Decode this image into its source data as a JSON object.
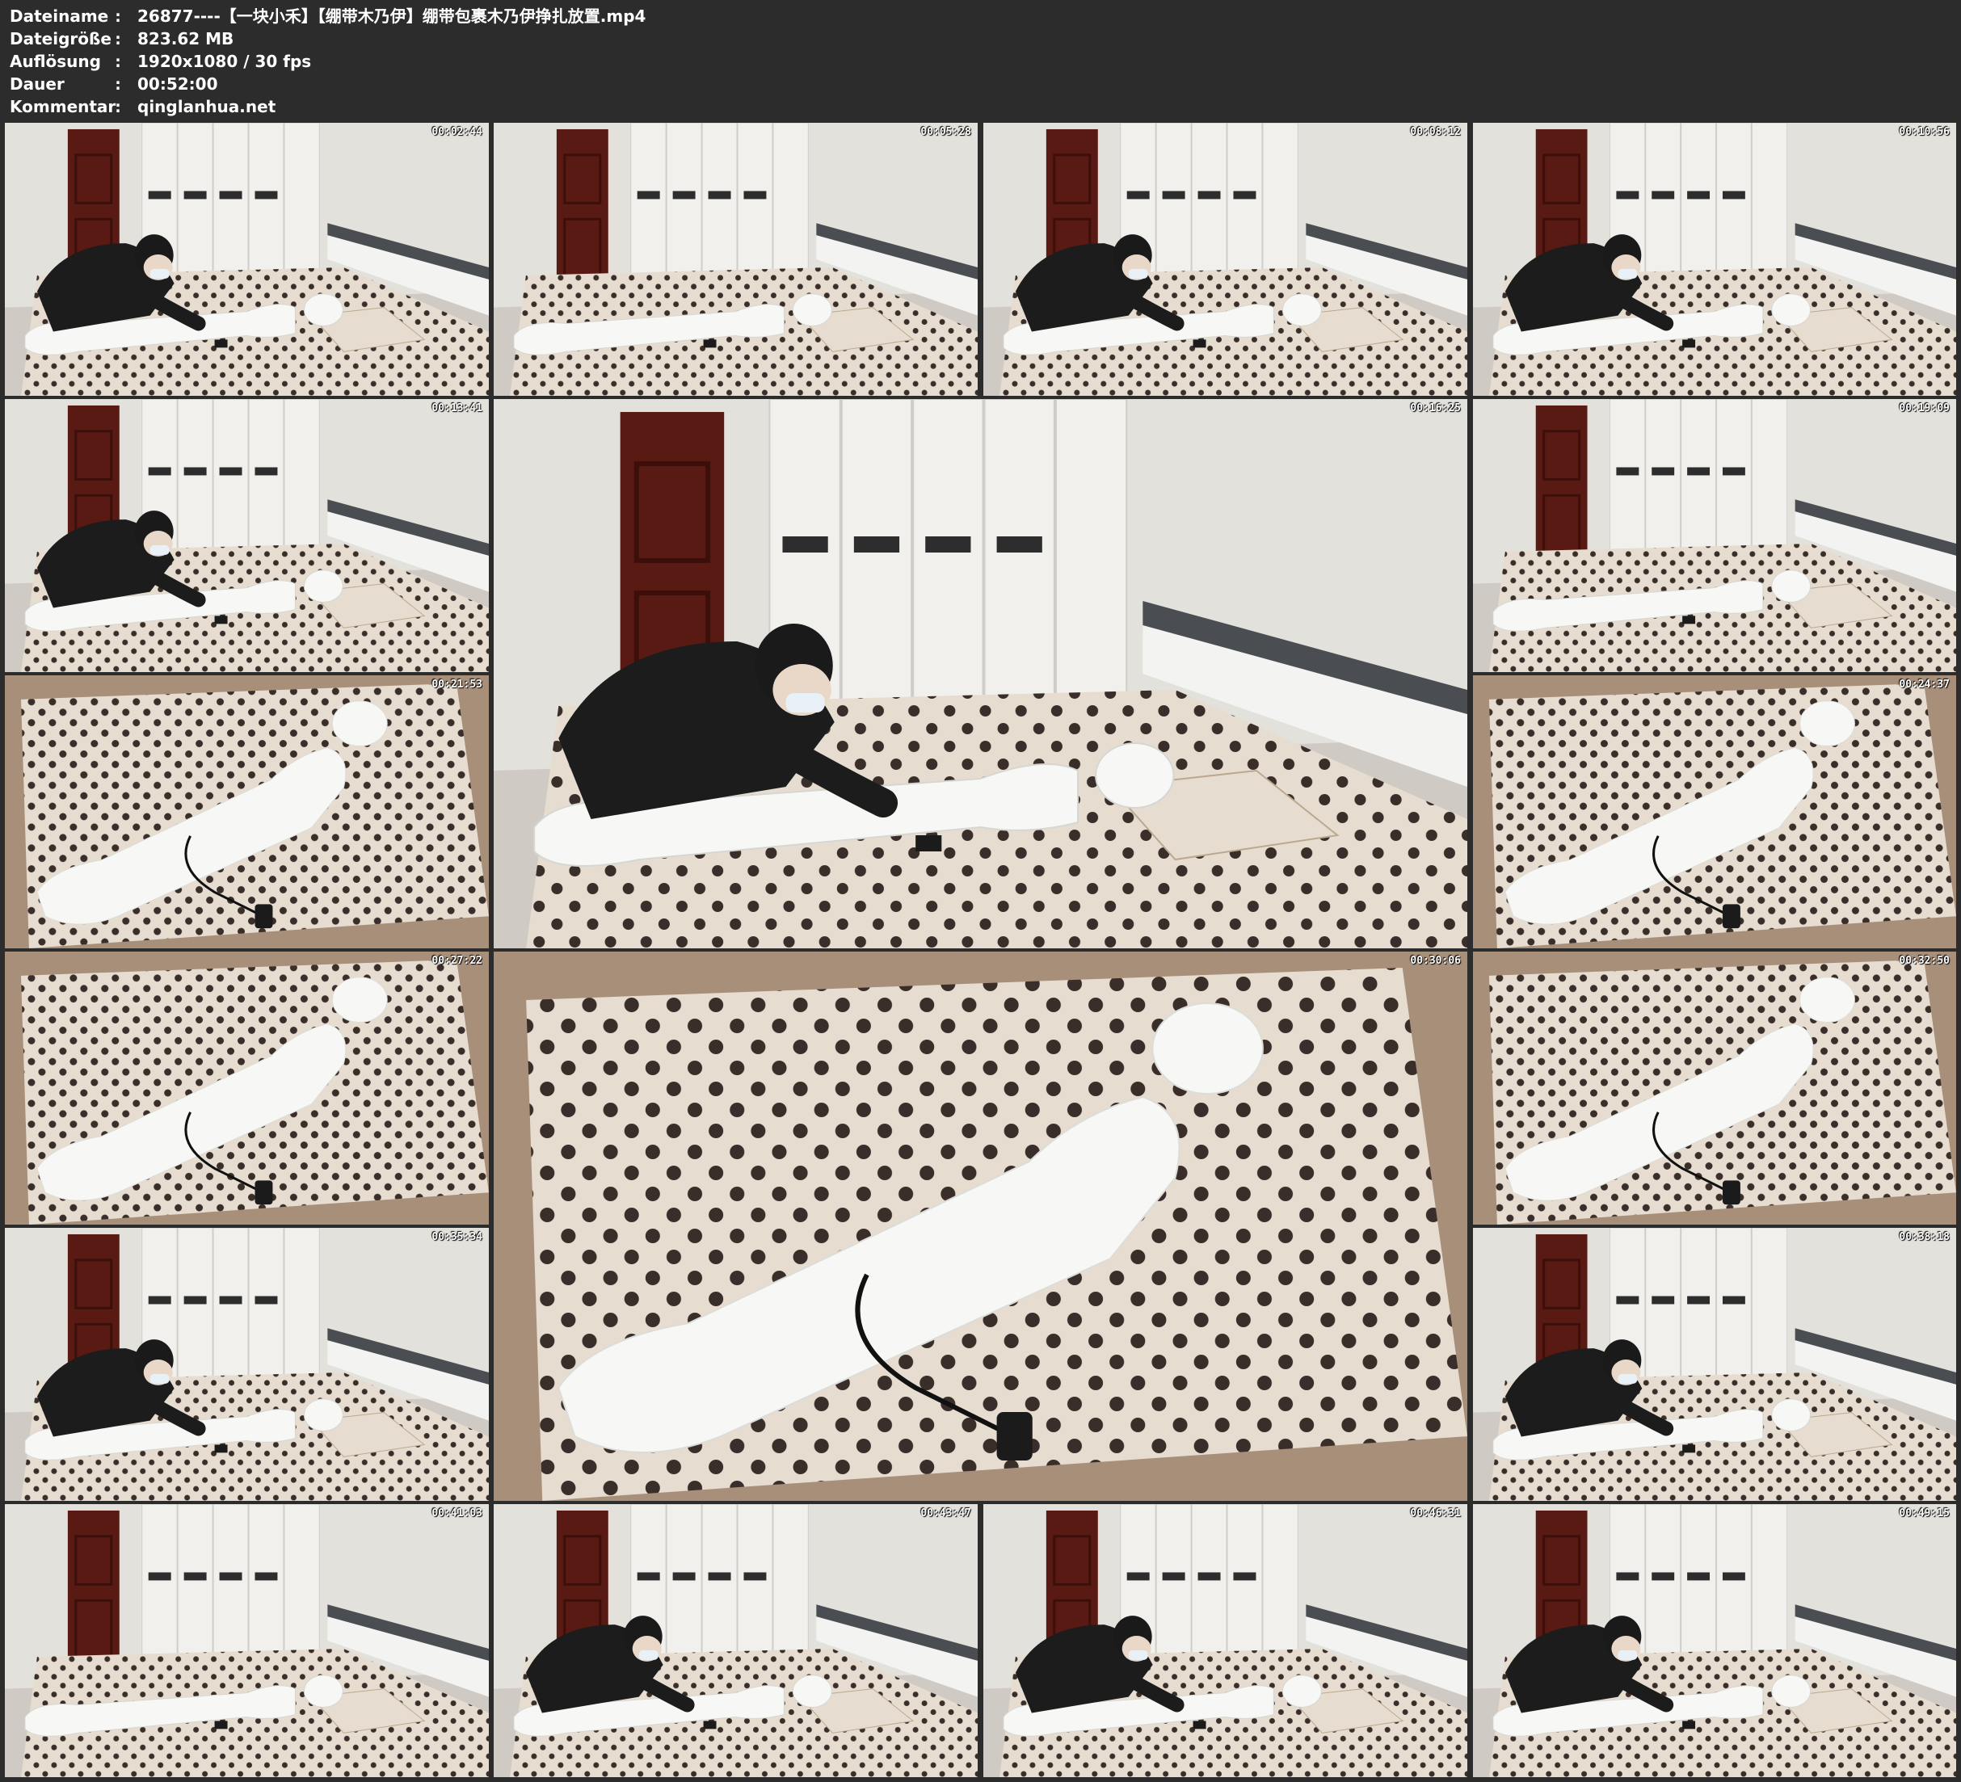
{
  "info": [
    {
      "label": "Dateiname",
      "value": "26877----【一块小禾】【绷带木乃伊】绷带包裹木乃伊挣扎放置.mp4"
    },
    {
      "label": "Dateigröße",
      "value": "823.62 MB"
    },
    {
      "label": "Auflösung",
      "value": "1920x1080 / 30 fps"
    },
    {
      "label": "Dauer",
      "value": "00:52:00"
    },
    {
      "label": "Kommentar",
      "value": "qinglanhua.net"
    }
  ],
  "separator": ":",
  "thumbnails": [
    {
      "timestamp": "00:02:44",
      "scene": "room-man"
    },
    {
      "timestamp": "00:05:28",
      "scene": "room"
    },
    {
      "timestamp": "00:08:12",
      "scene": "room-man"
    },
    {
      "timestamp": "00:10:56",
      "scene": "room-man"
    },
    {
      "timestamp": "00:13:41",
      "scene": "room-man"
    },
    {
      "timestamp": "00:16:25",
      "scene": "room-man"
    },
    {
      "timestamp": "00:19:09",
      "scene": "room"
    },
    {
      "timestamp": "00:21:53",
      "scene": "closeup"
    },
    {
      "timestamp": "00:24:37",
      "scene": "closeup"
    },
    {
      "timestamp": "00:27:22",
      "scene": "closeup"
    },
    {
      "timestamp": "00:30:06",
      "scene": "closeup"
    },
    {
      "timestamp": "00:32:50",
      "scene": "closeup"
    },
    {
      "timestamp": "00:35:34",
      "scene": "room-man"
    },
    {
      "timestamp": "00:38:18",
      "scene": "room-man"
    },
    {
      "timestamp": "00:41:03",
      "scene": "room"
    },
    {
      "timestamp": "00:43:47",
      "scene": "room-man"
    },
    {
      "timestamp": "00:46:31",
      "scene": "room-man"
    },
    {
      "timestamp": "00:49:15",
      "scene": "room-man"
    }
  ],
  "colors": {
    "background": "#2c2c2c",
    "wall": "#e3e1dc",
    "door": "#5a1a14",
    "wardrobe": "#f1f0ec",
    "sheet": "#e6ddd0",
    "dots": "#3a2e2a",
    "border": "#a88f7a",
    "figure": "#f7f7f5",
    "shirt": "#1c1c1c"
  }
}
